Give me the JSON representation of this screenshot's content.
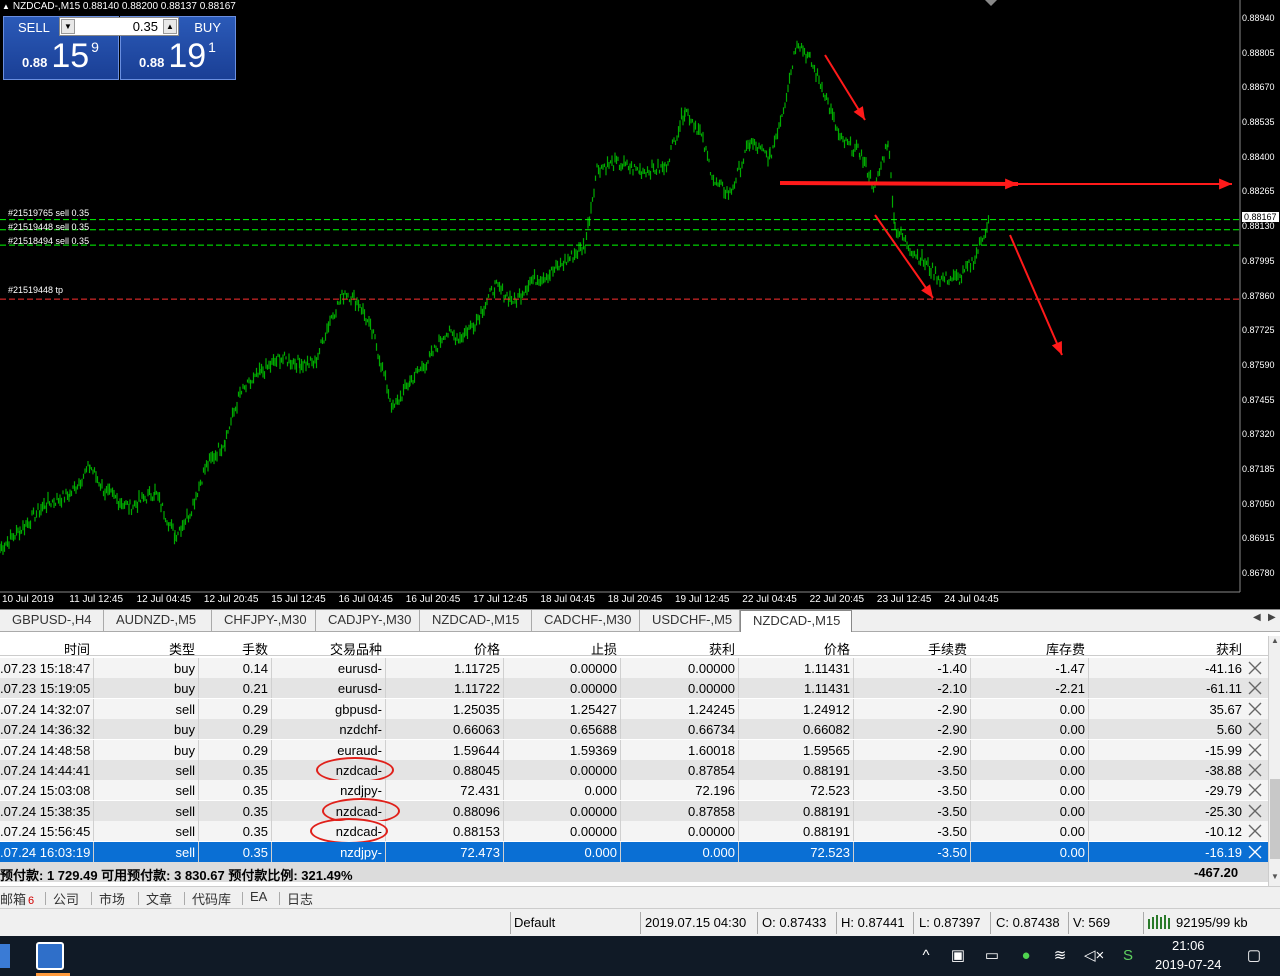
{
  "chart": {
    "title": "NZDCAD-,M15  0.88140 0.88200 0.88137 0.88167",
    "sell_label": "SELL",
    "buy_label": "BUY",
    "lot_value": "0.35",
    "sell_price": {
      "small": "0.88",
      "big": "15",
      "sup": "9"
    },
    "buy_price": {
      "small": "0.88",
      "big": "19",
      "sup": "1"
    },
    "price_axis": [
      "0.88940",
      "0.88805",
      "0.88670",
      "0.88535",
      "0.88400",
      "0.88265",
      "0.88130",
      "0.87995",
      "0.87860",
      "0.87725",
      "0.87590",
      "0.87455",
      "0.87320",
      "0.87185",
      "0.87050",
      "0.86915",
      "0.86780"
    ],
    "current_price": "0.88167",
    "time_axis": [
      "10 Jul 2019",
      "11 Jul 12:45",
      "12 Jul 04:45",
      "12 Jul 20:45",
      "15 Jul 12:45",
      "16 Jul 04:45",
      "16 Jul 20:45",
      "17 Jul 12:45",
      "18 Jul 04:45",
      "18 Jul 20:45",
      "19 Jul 12:45",
      "22 Jul 04:45",
      "22 Jul 20:45",
      "23 Jul 12:45",
      "24 Jul 04:45"
    ],
    "order_lines": [
      "#21519765 sell 0.35",
      "#21519448 sell 0.35",
      "#21518494 sell 0.35",
      "#21519448 tp"
    ],
    "colors": {
      "candles": "#00aa00",
      "order_line": "#00ff00",
      "tp_line": "#ff3030",
      "arrows": "#ff1a1a",
      "background": "#000000"
    }
  },
  "symbol_tabs": [
    "GBPUSD-,H4",
    "AUDNZD-,M5",
    "CHFJPY-,M30",
    "CADJPY-,M30",
    "NZDCAD-,M15",
    "CADCHF-,M30",
    "USDCHF-,M5",
    "NZDCAD-,M15"
  ],
  "active_tab_index": 7,
  "table": {
    "headers": [
      "时间",
      "类型",
      "手数",
      "交易品种",
      "价格",
      "止损",
      "获利",
      "价格",
      "手续费",
      "库存费",
      "获利"
    ],
    "rows": [
      [
        ".07.23 15:18:47",
        "buy",
        "0.14",
        "eurusd-",
        "1.11725",
        "0.00000",
        "0.00000",
        "1.11431",
        "-1.40",
        "-1.47",
        "-41.16"
      ],
      [
        ".07.23 15:19:05",
        "buy",
        "0.21",
        "eurusd-",
        "1.11722",
        "0.00000",
        "0.00000",
        "1.11431",
        "-2.10",
        "-2.21",
        "-61.11"
      ],
      [
        ".07.24 14:32:07",
        "sell",
        "0.29",
        "gbpusd-",
        "1.25035",
        "1.25427",
        "1.24245",
        "1.24912",
        "-2.90",
        "0.00",
        "35.67"
      ],
      [
        ".07.24 14:36:32",
        "buy",
        "0.29",
        "nzdchf-",
        "0.66063",
        "0.65688",
        "0.66734",
        "0.66082",
        "-2.90",
        "0.00",
        "5.60"
      ],
      [
        ".07.24 14:48:58",
        "buy",
        "0.29",
        "euraud-",
        "1.59644",
        "1.59369",
        "1.60018",
        "1.59565",
        "-2.90",
        "0.00",
        "-15.99"
      ],
      [
        ".07.24 14:44:41",
        "sell",
        "0.35",
        "nzdcad-",
        "0.88045",
        "0.00000",
        "0.87854",
        "0.88191",
        "-3.50",
        "0.00",
        "-38.88"
      ],
      [
        ".07.24 15:03:08",
        "sell",
        "0.35",
        "nzdjpy-",
        "72.431",
        "0.000",
        "72.196",
        "72.523",
        "-3.50",
        "0.00",
        "-29.79"
      ],
      [
        ".07.24 15:38:35",
        "sell",
        "0.35",
        "nzdcad-",
        "0.88096",
        "0.00000",
        "0.87858",
        "0.88191",
        "-3.50",
        "0.00",
        "-25.30"
      ],
      [
        ".07.24 15:56:45",
        "sell",
        "0.35",
        "nzdcad-",
        "0.88153",
        "0.00000",
        "0.00000",
        "0.88191",
        "-3.50",
        "0.00",
        "-10.12"
      ],
      [
        ".07.24 16:03:19",
        "sell",
        "0.35",
        "nzdjpy-",
        "72.473",
        "0.000",
        "0.000",
        "72.523",
        "-3.50",
        "0.00",
        "-16.19"
      ]
    ],
    "selected_row": 9,
    "circled_rows": [
      5,
      7,
      8
    ],
    "summary": "预付款: 1 729.49  可用预付款: 3 830.67  预付款比例: 321.49%",
    "summary_total": "-467.20"
  },
  "bottom_tabs": [
    {
      "label": "邮箱",
      "count": "6"
    },
    {
      "label": "公司"
    },
    {
      "label": "市场"
    },
    {
      "label": "文章"
    },
    {
      "label": "代码库"
    },
    {
      "label": "EA"
    },
    {
      "label": "日志"
    }
  ],
  "status": {
    "profile": "Default",
    "datetime": "2019.07.15 04:30",
    "open": "O: 0.87433",
    "high": "H: 0.87441",
    "low": "L: 0.87397",
    "close": "C: 0.87438",
    "volume": "V: 569",
    "traffic": "92195/99 kb"
  },
  "taskbar": {
    "time": "21:06",
    "date": "2019-07-24"
  }
}
